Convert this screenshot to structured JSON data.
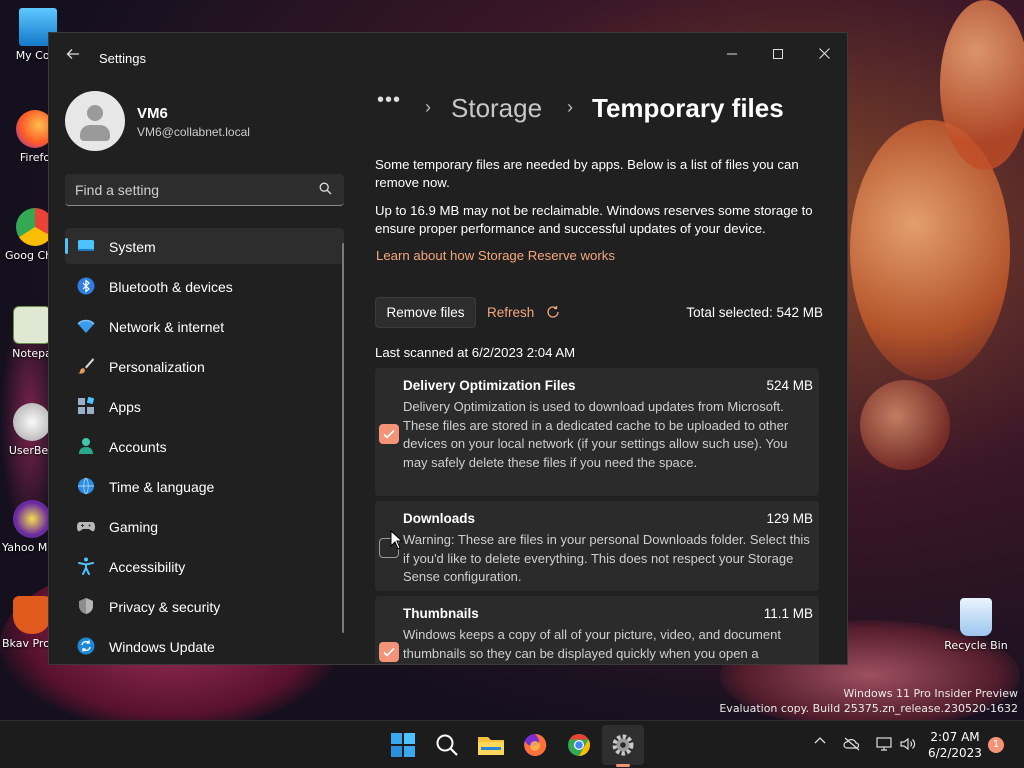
{
  "desktop": {
    "icons": [
      {
        "label": "My Com",
        "icon": "monitor-icon"
      },
      {
        "label": "Firefo",
        "icon": "firefox-icon"
      },
      {
        "label": "Goog Chron",
        "icon": "chrome-icon"
      },
      {
        "label": "Notepa",
        "icon": "notepad-icon"
      },
      {
        "label": "UserBen",
        "icon": "userbench-icon"
      },
      {
        "label": "Yahoo Messe",
        "icon": "yahoo-icon"
      },
      {
        "label": "Bkav Pro Internet Sec",
        "icon": "bkav-icon"
      }
    ],
    "recycle_bin": "Recycle Bin",
    "watermark_line1": "Windows 11 Pro Insider Preview",
    "watermark_line2": "Evaluation copy. Build 25375.zn_release.230520-1632"
  },
  "window": {
    "app_title": "Settings",
    "user": {
      "name": "VM6",
      "email": "VM6@collabnet.local"
    },
    "search": {
      "placeholder": "Find a setting"
    },
    "nav": [
      {
        "label": "System",
        "icon": "system-icon",
        "active": true
      },
      {
        "label": "Bluetooth & devices",
        "icon": "bluetooth-icon"
      },
      {
        "label": "Network & internet",
        "icon": "wifi-icon"
      },
      {
        "label": "Personalization",
        "icon": "brush-icon"
      },
      {
        "label": "Apps",
        "icon": "apps-icon"
      },
      {
        "label": "Accounts",
        "icon": "accounts-icon"
      },
      {
        "label": "Time & language",
        "icon": "globe-clock-icon"
      },
      {
        "label": "Gaming",
        "icon": "gamepad-icon"
      },
      {
        "label": "Accessibility",
        "icon": "accessibility-icon"
      },
      {
        "label": "Privacy & security",
        "icon": "shield-icon"
      },
      {
        "label": "Windows Update",
        "icon": "update-icon"
      }
    ],
    "breadcrumb": {
      "dots": "•••",
      "parent": "Storage",
      "current": "Temporary files"
    },
    "intro_text": "Some temporary files are needed by apps. Below is a list of files you can remove now.",
    "reserve_text": "Up to 16.9 MB may not be reclaimable. Windows reserves some storage to ensure proper performance and successful updates of your device.",
    "reserve_link": "Learn about how Storage Reserve works",
    "remove_button": "Remove files",
    "refresh_button": "Refresh",
    "total_selected": "Total selected: 542 MB",
    "last_scanned": "Last scanned at 6/2/2023 2:04 AM",
    "items": [
      {
        "title": "Delivery Optimization Files",
        "size": "524 MB",
        "checked": true,
        "desc": "Delivery Optimization is used to download updates from Microsoft. These files are stored in a dedicated cache to be uploaded to other devices on your local network (if your settings allow such use). You may safely delete these files if you need the space."
      },
      {
        "title": "Downloads",
        "size": "129 MB",
        "checked": false,
        "desc": "Warning: These are files in your personal Downloads folder. Select this if you'd like to delete everything. This does not respect your Storage Sense configuration."
      },
      {
        "title": "Thumbnails",
        "size": "11.1 MB",
        "checked": true,
        "desc": "Windows keeps a copy of all of your picture, video, and document thumbnails so they can be displayed quickly when you open a"
      }
    ]
  },
  "taskbar": {
    "time": "2:07 AM",
    "date": "6/2/2023",
    "notification_count": "1"
  },
  "colors": {
    "accent": "#f39479",
    "link": "#f3a77e",
    "selection_bar": "#4cc2ff"
  }
}
